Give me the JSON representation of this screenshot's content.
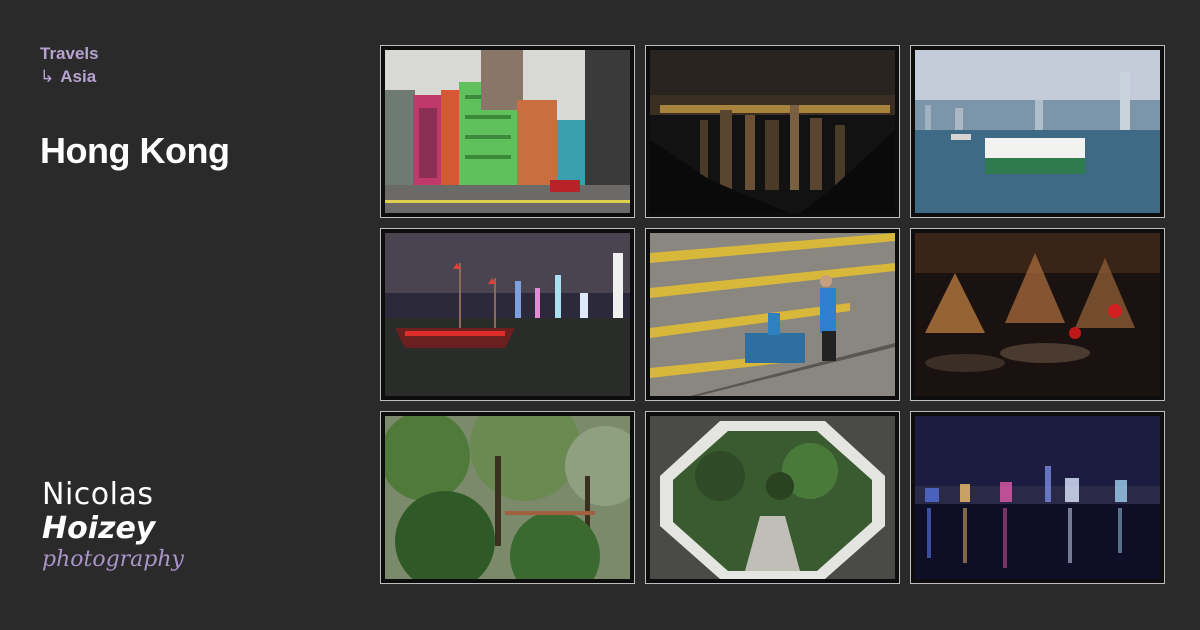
{
  "breadcrumb": {
    "parent": "Travels",
    "arrow": "↳",
    "current": "Asia"
  },
  "page": {
    "title": "Hong Kong"
  },
  "logo": {
    "line1": "Nicolas",
    "line2": "Hoizey",
    "line3": "photography"
  },
  "colors": {
    "background": "#2b2a2b",
    "accent": "#b6a2cf",
    "title": "#ffffff",
    "thumb_border": "#bdbdbd"
  },
  "gallery": {
    "photos": [
      {
        "subject": "colorful-buildings-street"
      },
      {
        "subject": "city-night-from-peak"
      },
      {
        "subject": "star-ferry-harbour"
      },
      {
        "subject": "junk-boat-night-skyline"
      },
      {
        "subject": "man-with-gas-cylinders"
      },
      {
        "subject": "temple-incense-coils"
      },
      {
        "subject": "green-trees-park"
      },
      {
        "subject": "octagonal-garden-gate"
      },
      {
        "subject": "harbour-night-reflections"
      }
    ]
  }
}
